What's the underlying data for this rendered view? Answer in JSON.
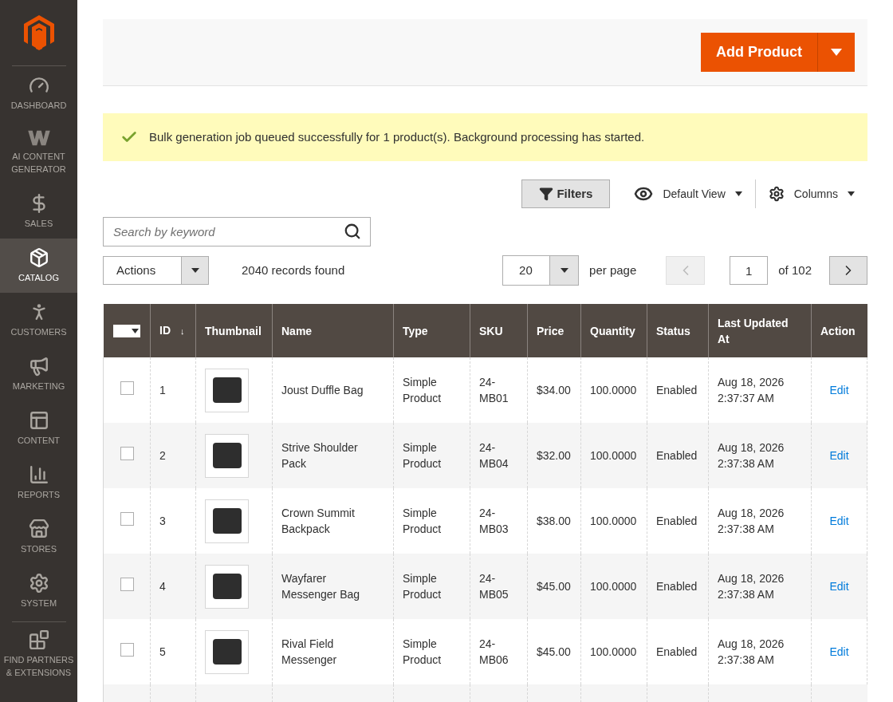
{
  "sidebar": {
    "items": [
      {
        "label": "DASHBOARD",
        "selected": false,
        "kind": "gauge"
      },
      {
        "label": "AI CONTENT GENERATOR",
        "selected": false,
        "kind": "w"
      },
      {
        "label": "SALES",
        "selected": false,
        "kind": "dollar"
      },
      {
        "label": "CATALOG",
        "selected": true,
        "kind": "box"
      },
      {
        "label": "CUSTOMERS",
        "selected": false,
        "kind": "person"
      },
      {
        "label": "MARKETING",
        "selected": false,
        "kind": "megaphone"
      },
      {
        "label": "CONTENT",
        "selected": false,
        "kind": "layout"
      },
      {
        "label": "REPORTS",
        "selected": false,
        "kind": "bars"
      },
      {
        "label": "STORES",
        "selected": false,
        "kind": "store"
      },
      {
        "label": "SYSTEM",
        "selected": false,
        "kind": "gear"
      },
      {
        "label": "FIND PARTNERS & EXTENSIONS",
        "selected": false,
        "kind": "brick"
      }
    ]
  },
  "header": {
    "add_button": "Add Product"
  },
  "message": "Bulk generation job queued successfully for 1 product(s). Background processing has started.",
  "toolbar": {
    "filters": "Filters",
    "view": "Default View",
    "columns": "Columns",
    "search": {
      "placeholder": "Search by keyword"
    },
    "actions": "Actions",
    "records": "2040 records found",
    "per_page": "20",
    "per_page_label": "per page",
    "page": "1",
    "of_pages": "of 102"
  },
  "table": {
    "columns": [
      {
        "label": "ID",
        "sort": "↓"
      },
      {
        "label": "Thumbnail"
      },
      {
        "label": "Name"
      },
      {
        "label": "Type"
      },
      {
        "label": "SKU"
      },
      {
        "label": "Price"
      },
      {
        "label": "Quantity"
      },
      {
        "label": "Status"
      },
      {
        "label": "Last Updated At"
      },
      {
        "label": "Action"
      }
    ],
    "rows": [
      {
        "checked": false,
        "id": "1",
        "name": "Joust Duffle Bag",
        "type": "Simple Product",
        "sku": "24-MB01",
        "price": "$34.00",
        "quantity": "100.0000",
        "status": "Enabled",
        "updated": "Aug 18, 2026 2:37:37 AM",
        "action": "Edit"
      },
      {
        "checked": false,
        "id": "2",
        "name": "Strive Shoulder Pack",
        "type": "Simple Product",
        "sku": "24-MB04",
        "price": "$32.00",
        "quantity": "100.0000",
        "status": "Enabled",
        "updated": "Aug 18, 2026 2:37:38 AM",
        "action": "Edit"
      },
      {
        "checked": false,
        "id": "3",
        "name": "Crown Summit Backpack",
        "type": "Simple Product",
        "sku": "24-MB03",
        "price": "$38.00",
        "quantity": "100.0000",
        "status": "Enabled",
        "updated": "Aug 18, 2026 2:37:38 AM",
        "action": "Edit"
      },
      {
        "checked": false,
        "id": "4",
        "name": "Wayfarer Messenger Bag",
        "type": "Simple Product",
        "sku": "24-MB05",
        "price": "$45.00",
        "quantity": "100.0000",
        "status": "Enabled",
        "updated": "Aug 18, 2026 2:37:38 AM",
        "action": "Edit"
      },
      {
        "checked": false,
        "id": "5",
        "name": "Rival Field Messenger",
        "type": "Simple Product",
        "sku": "24-MB06",
        "price": "$45.00",
        "quantity": "100.0000",
        "status": "Enabled",
        "updated": "Aug 18, 2026 2:37:38 AM",
        "action": "Edit"
      }
    ]
  }
}
